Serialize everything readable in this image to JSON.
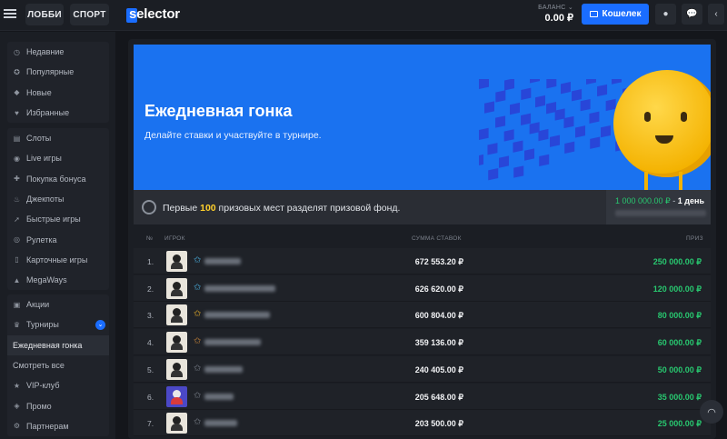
{
  "header": {
    "tabs": [
      "ЛОББИ",
      "СПОРТ"
    ],
    "logo": "selector",
    "balance_label": "БАЛАНС",
    "balance_value": "0.00 ₽",
    "wallet_label": "Кошелек"
  },
  "sidebar": {
    "group1": [
      {
        "label": "Недавние",
        "icon": "clock-icon"
      },
      {
        "label": "Популярные",
        "icon": "star-icon"
      },
      {
        "label": "Новые",
        "icon": "diamond-icon"
      },
      {
        "label": "Избранные",
        "icon": "heart-icon"
      }
    ],
    "group2": [
      {
        "label": "Слоты",
        "icon": "slots-icon"
      },
      {
        "label": "Live игры",
        "icon": "live-icon"
      },
      {
        "label": "Покупка бонуса",
        "icon": "bonus-icon"
      },
      {
        "label": "Джекпоты",
        "icon": "flame-icon"
      },
      {
        "label": "Быстрые игры",
        "icon": "rocket-icon"
      },
      {
        "label": "Рулетка",
        "icon": "roulette-icon"
      },
      {
        "label": "Карточные игры",
        "icon": "cards-icon"
      },
      {
        "label": "MegaWays",
        "icon": "megaways-icon"
      }
    ],
    "group3": [
      {
        "label": "Акции",
        "icon": "gift-icon"
      },
      {
        "label": "Турниры",
        "icon": "trophy-icon"
      },
      {
        "label": "Ежедневная гонка",
        "icon": ""
      },
      {
        "label": "Смотреть все",
        "icon": ""
      },
      {
        "label": "VIP-клуб",
        "icon": "vip-star-icon"
      },
      {
        "label": "Промо",
        "icon": "promo-icon"
      },
      {
        "label": "Партнерам",
        "icon": "partners-icon"
      }
    ]
  },
  "banner": {
    "title": "Ежедневная гонка",
    "subtitle": "Делайте ставки и участвуйте в турнире."
  },
  "prize_bar": {
    "text_before": "Первые ",
    "highlight": "100",
    "text_after": " призовых мест разделят призовой фонд.",
    "fund": "1 000 000.00 ₽",
    "sep": " - ",
    "duration": "1 день"
  },
  "table": {
    "headers": {
      "num": "№",
      "player": "ИГРОК",
      "bets": "СУММА СТАВОК",
      "prize": "ПРИЗ"
    },
    "rows": [
      {
        "num": "1.",
        "amount": "672 553.20 ₽",
        "prize": "250 000.00 ₽",
        "star_color": "#4db6e8"
      },
      {
        "num": "2.",
        "amount": "626 620.00 ₽",
        "prize": "120 000.00 ₽",
        "star_color": "#4db6e8"
      },
      {
        "num": "3.",
        "amount": "600 804.00 ₽",
        "prize": "80 000.00 ₽",
        "star_color": "#f0b429"
      },
      {
        "num": "4.",
        "amount": "359 136.00 ₽",
        "prize": "60 000.00 ₽",
        "star_color": "#d08a3a"
      },
      {
        "num": "5.",
        "amount": "240 405.00 ₽",
        "prize": "50 000.00 ₽",
        "star_color": "#7c828c"
      },
      {
        "num": "6.",
        "amount": "205 648.00 ₽",
        "prize": "35 000.00 ₽",
        "star_color": "#7c828c"
      },
      {
        "num": "7.",
        "amount": "203 500.00 ₽",
        "prize": "25 000.00 ₽",
        "star_color": "#7c828c"
      }
    ]
  },
  "colors": {
    "accent": "#1a6dff",
    "prize_green": "#28c76f",
    "highlight_yellow": "#ffd02b"
  }
}
